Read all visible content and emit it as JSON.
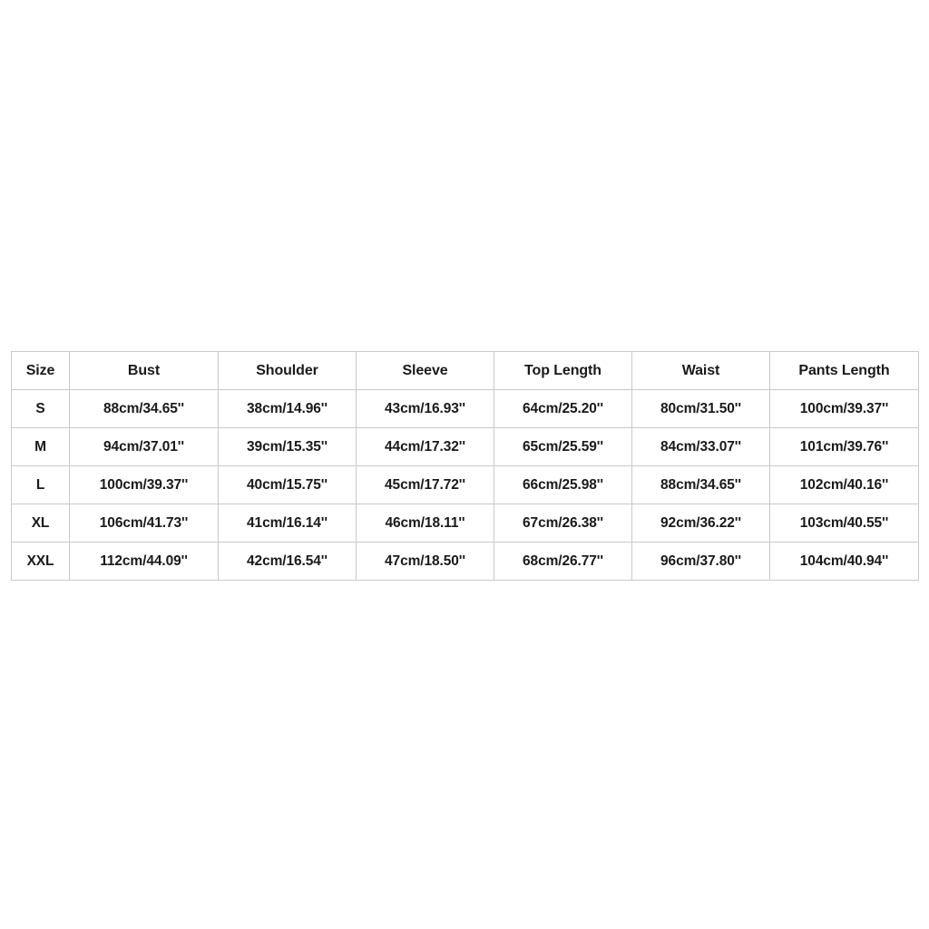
{
  "document": {
    "type": "garment-size-chart",
    "background_color": "#ffffff",
    "border_color": "#c9c9c9",
    "text_color": "#1a1a1a"
  },
  "table": {
    "columns": [
      "Size",
      "Bust",
      "Shoulder",
      "Sleeve",
      "Top Length",
      "Waist",
      "Pants Length"
    ],
    "rows": [
      {
        "size": "S",
        "bust": "88cm/34.65''",
        "shoulder": "38cm/14.96''",
        "sleeve": "43cm/16.93''",
        "top_length": "64cm/25.20''",
        "waist": "80cm/31.50''",
        "pants_length": "100cm/39.37''"
      },
      {
        "size": "M",
        "bust": "94cm/37.01''",
        "shoulder": "39cm/15.35''",
        "sleeve": "44cm/17.32''",
        "top_length": "65cm/25.59''",
        "waist": "84cm/33.07''",
        "pants_length": "101cm/39.76''"
      },
      {
        "size": "L",
        "bust": "100cm/39.37''",
        "shoulder": "40cm/15.75''",
        "sleeve": "45cm/17.72''",
        "top_length": "66cm/25.98''",
        "waist": "88cm/34.65''",
        "pants_length": "102cm/40.16''"
      },
      {
        "size": "XL",
        "bust": "106cm/41.73''",
        "shoulder": "41cm/16.14''",
        "sleeve": "46cm/18.11''",
        "top_length": "67cm/26.38''",
        "waist": "92cm/36.22''",
        "pants_length": "103cm/40.55''"
      },
      {
        "size": "XXL",
        "bust": "112cm/44.09''",
        "shoulder": "42cm/16.54''",
        "sleeve": "47cm/18.50''",
        "top_length": "68cm/26.77''",
        "waist": "96cm/37.80''",
        "pants_length": "104cm/40.94''"
      }
    ]
  }
}
